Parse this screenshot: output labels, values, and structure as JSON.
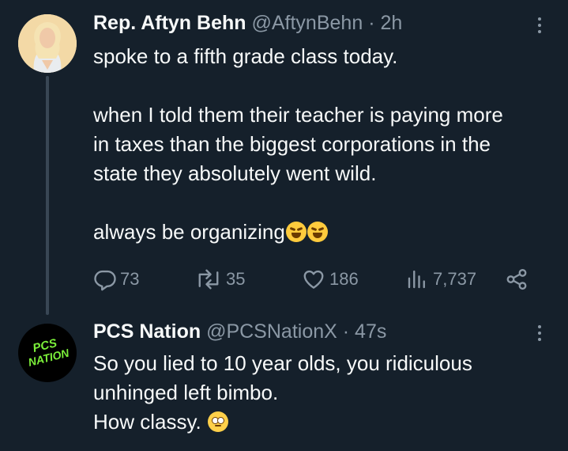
{
  "tweets": [
    {
      "name": "Rep. Aftyn Behn",
      "handle": "@AftynBehn",
      "separator": "·",
      "time": "2h",
      "text": "spoke to a fifth grade class today.\n\nwhen I told them their teacher is paying more\nin taxes than the biggest corporations in the\nstate they absolutely went wild.\n\nalways be organizing",
      "emoji": [
        "rolling-on-floor-laughing",
        "rolling-on-floor-laughing"
      ],
      "stats": {
        "replies": "73",
        "reposts": "35",
        "likes": "186",
        "views": "7,737"
      }
    },
    {
      "name": "PCS Nation",
      "handle": "@PCSNationX",
      "separator": "·",
      "time": "47s",
      "text": "So you lied to 10 year olds, you ridiculous\nunhinged left bimbo.\nHow classy.",
      "emoji": [
        "face-with-rolling-eyes"
      ],
      "avatar_text": [
        "PCS",
        "NATION"
      ]
    }
  ],
  "colors": {
    "background": "#15202b",
    "text": "#f7f9f9",
    "muted": "#8b98a5",
    "thread_line": "#394755",
    "pcs_avatar_text": "#7cf03a"
  }
}
